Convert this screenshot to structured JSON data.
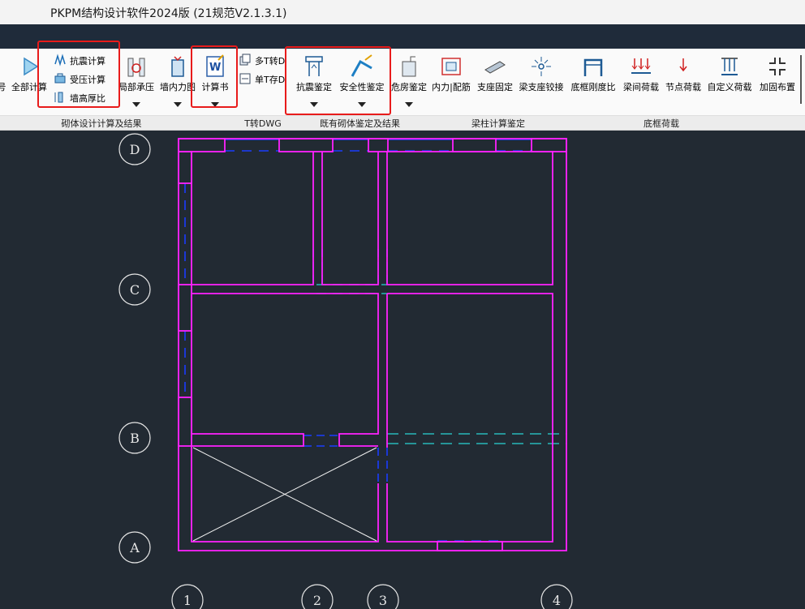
{
  "app": {
    "title": "PKPM结构设计软件2024版 (21规范V2.1.3.1)"
  },
  "ribbon": {
    "cut_label": "号",
    "calc_all": "全部计算",
    "seismic_calc": "抗震计算",
    "compress_calc": "受压计算",
    "wall_ratio": "墙高厚比",
    "local_bearing": "局部承压",
    "wall_force": "墙内力图",
    "calc_book": "计算书",
    "multi_t": "多T转D",
    "single_t": "单T存D",
    "seismic_check": "抗震鉴定",
    "safety_check": "安全性鉴定",
    "danger_check": "危房鉴定",
    "inner_force": "内力|配筋",
    "support_fixed": "支座固定",
    "support_hinge": "梁支座铰接",
    "frame_stiff": "底框刚度比",
    "beam_load": "梁间荷载",
    "node_load": "节点荷载",
    "custom_load": "自定义荷载",
    "reinforce": "加固布置",
    "groups": {
      "masonry": "砌体设计计算及结果",
      "t2dwg": "T转DWG",
      "existing": "既有砌体鉴定及结果",
      "beam_col": "梁柱计算鉴定",
      "frame_load": "底框荷载"
    }
  },
  "axes": {
    "a": "A",
    "b": "B",
    "c": "C",
    "d": "D",
    "n1": "1",
    "n2": "2",
    "n3": "3",
    "n4": "4"
  },
  "colors": {
    "wall": "#ff22ff",
    "beam": "#1a3cff",
    "dim": "#2ad4d4",
    "highlight": "#e81b1b",
    "canvas": "#222a33"
  }
}
